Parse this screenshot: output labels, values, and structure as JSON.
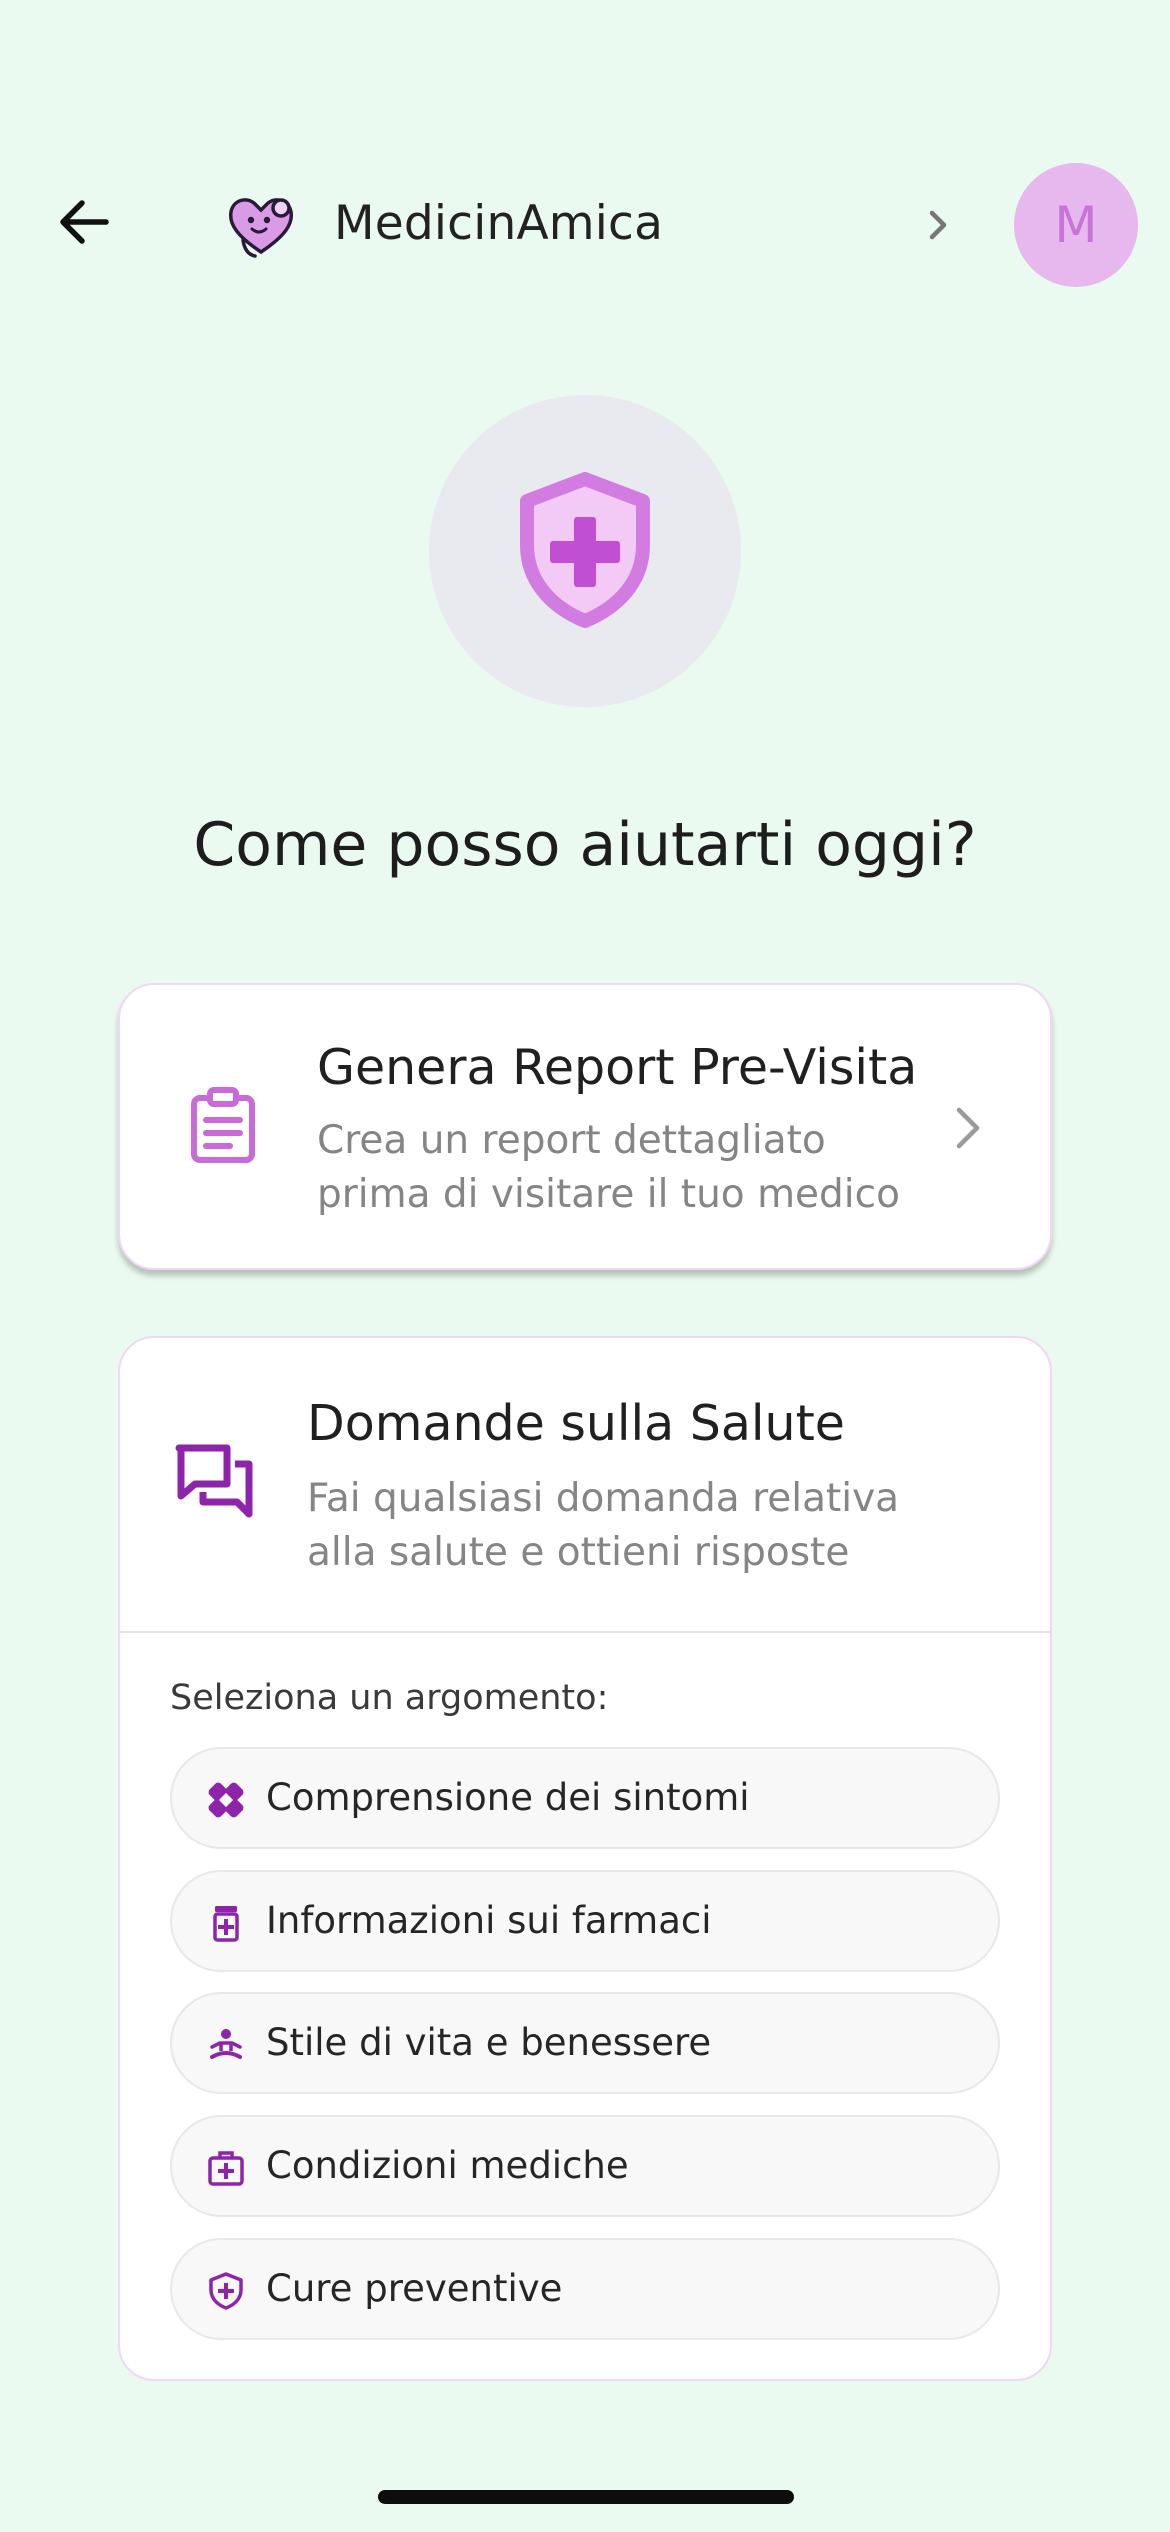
{
  "header": {
    "brand": "MedicinAmica",
    "avatar_initial": "M",
    "icons": {
      "back": "arrow-left-icon",
      "logo": "heart-stethoscope-logo",
      "chevron": "chevron-right-icon"
    }
  },
  "hero": {
    "icon": "shield-plus-icon",
    "headline": "Come posso aiutarti oggi?"
  },
  "report_card": {
    "title": "Genera Report Pre-Visita",
    "description": "Crea un report dettagliato prima di visitare il tuo medico",
    "icon": "clipboard-list-icon"
  },
  "questions_card": {
    "title": "Domande sulla Salute",
    "description": "Fai qualsiasi domanda relativa alla salute e ottieni risposte",
    "icon": "chat-bubbles-icon",
    "topic_prompt": "Seleziona un argomento:",
    "topics": [
      {
        "label": "Comprensione dei sintomi",
        "icon": "bandage-icon"
      },
      {
        "label": "Informazioni sui farmaci",
        "icon": "medicine-bottle-icon"
      },
      {
        "label": "Stile di vita e benessere",
        "icon": "meditation-icon"
      },
      {
        "label": "Condizioni mediche",
        "icon": "medical-bag-icon"
      },
      {
        "label": "Cure preventive",
        "icon": "shield-plus-icon"
      }
    ]
  },
  "colors": {
    "background": "#eafaf1",
    "accent_light": "#cf7bdd",
    "accent_dark": "#8e24aa",
    "avatar_bg": "#e6b8ee"
  }
}
